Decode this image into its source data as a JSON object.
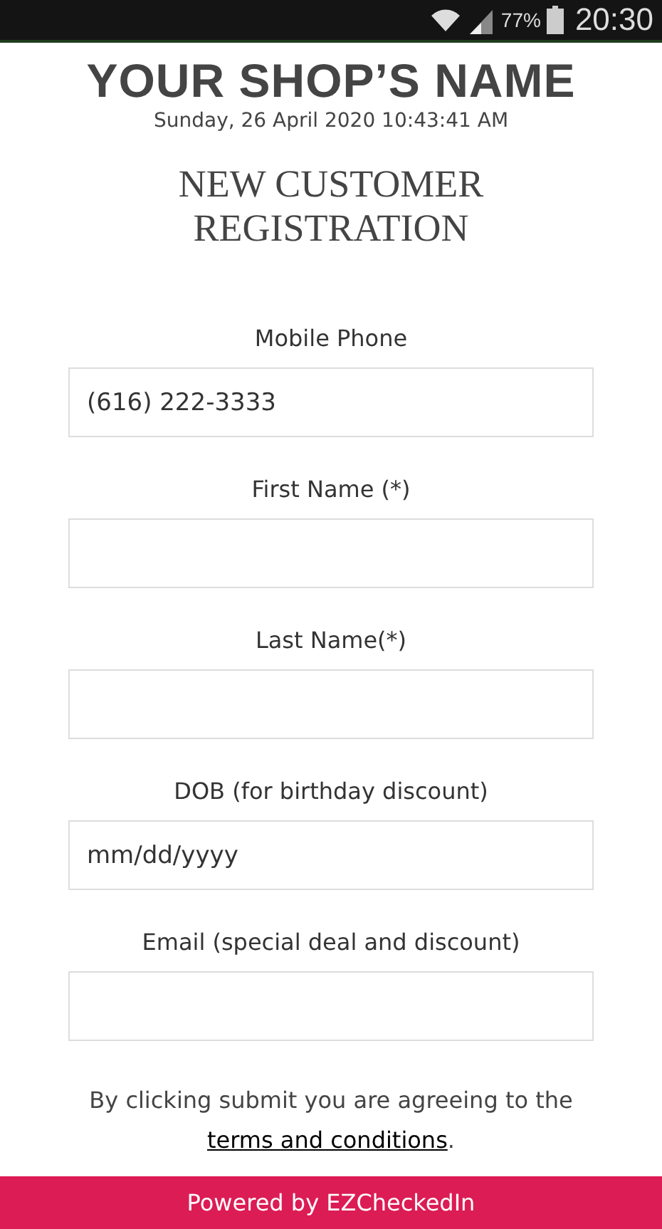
{
  "status_bar": {
    "battery": "77%",
    "time": "20:30"
  },
  "shop_name": "YOUR SHOP’S NAME",
  "datetime": "Sunday, 26 April 2020 10:43:41 AM",
  "heading": "NEW CUSTOMER REGISTRATION",
  "fields": [
    {
      "label": "Mobile Phone",
      "value": "(616) 222-3333"
    },
    {
      "label": "First Name (*)"
    },
    {
      "label": "Last Name(*)"
    },
    {
      "label": "DOB (for birthday discount)",
      "placeholder": "mm/dd/yyyy"
    },
    {
      "label": "Email (special deal and discount)"
    }
  ],
  "terms": {
    "before": "By clicking submit you are agreeing to the ",
    "link": "terms and conditions",
    "after": "."
  },
  "footer": "Powered by EZCheckedIn"
}
